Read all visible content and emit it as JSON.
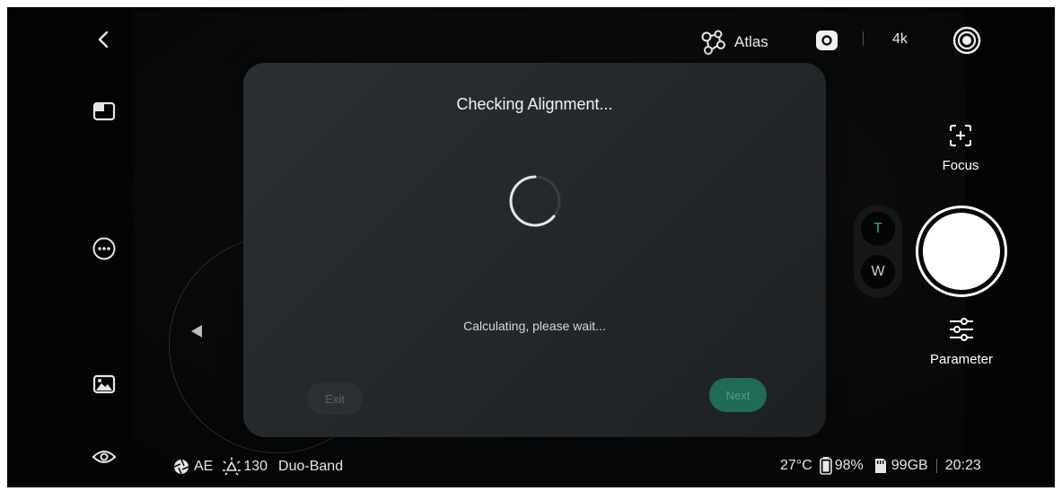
{
  "topbar": {
    "atlas_label": "Atlas",
    "resolution_label": "4k"
  },
  "modal": {
    "title": "Checking Alignment...",
    "message": "Calculating, please wait...",
    "exit_label": "Exit",
    "next_label": "Next"
  },
  "zoom": {
    "tele_label": "T",
    "wide_label": "W"
  },
  "right_controls": {
    "focus_label": "Focus",
    "parameter_label": "Parameter"
  },
  "status_bar": {
    "exposure_mode": "AE",
    "brightness_value": "130",
    "band_mode": "Duo-Band",
    "temperature": "27°C",
    "battery": "98%",
    "storage": "99GB",
    "time": "20:23"
  },
  "colors": {
    "accent_green": "#1f6b55",
    "tele_green": "#2fae77",
    "background": "#070809"
  },
  "icons": {
    "back": "chevron-left-icon",
    "layout": "split-window-icon",
    "more": "more-dots-icon",
    "gallery": "image-icon",
    "view": "eye-icon",
    "atlas": "molecule-icon",
    "record_mode": "camera-mode-icon",
    "lens": "target-icon",
    "focus": "focus-frame-icon",
    "parameter": "sliders-icon",
    "aperture": "aperture-icon",
    "brightness": "sun-icon",
    "battery": "battery-icon",
    "storage": "sd-card-icon"
  }
}
